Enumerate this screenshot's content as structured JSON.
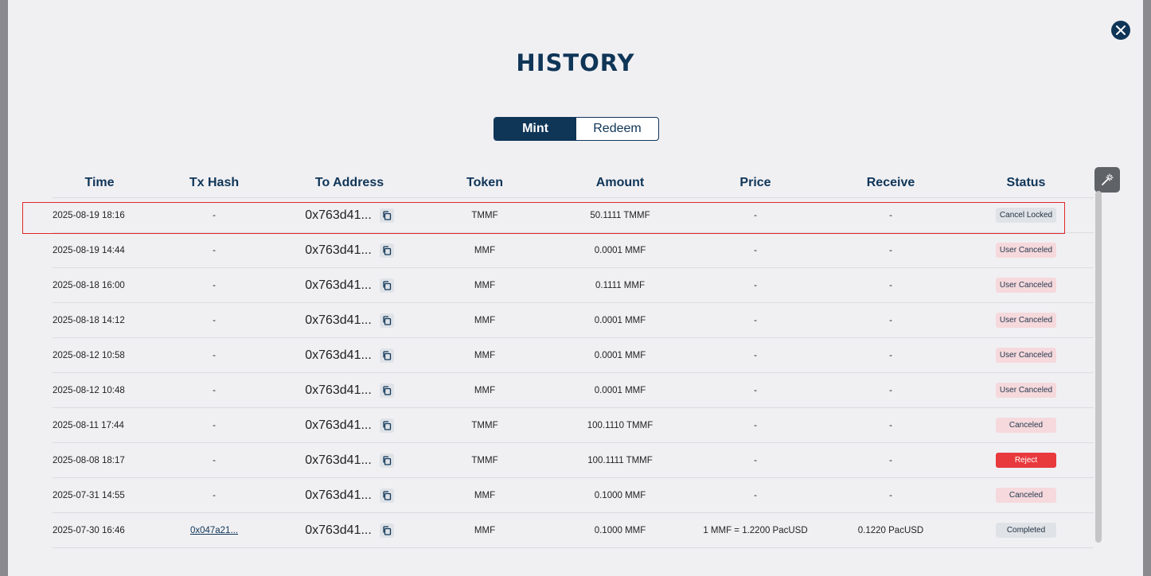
{
  "modal": {
    "title": "HISTORY",
    "close_icon": "close-icon"
  },
  "tabs": [
    {
      "label": "Mint",
      "active": true
    },
    {
      "label": "Redeem",
      "active": false
    }
  ],
  "columns": [
    "Time",
    "Tx Hash",
    "To Address",
    "Token",
    "Amount",
    "Price",
    "Receive",
    "Status"
  ],
  "rows": [
    {
      "time": "2025-08-19 18:16",
      "hash": "-",
      "address": "0x763d41...",
      "token": "TMMF",
      "amount": "50.1111 TMMF",
      "price": "-",
      "receive": "-",
      "status": "Cancel Locked",
      "status_type": "locked"
    },
    {
      "time": "2025-08-19 14:44",
      "hash": "-",
      "address": "0x763d41...",
      "token": "MMF",
      "amount": "0.0001 MMF",
      "price": "-",
      "receive": "-",
      "status": "User Canceled",
      "status_type": "cancel"
    },
    {
      "time": "2025-08-18 16:00",
      "hash": "-",
      "address": "0x763d41...",
      "token": "MMF",
      "amount": "0.1111 MMF",
      "price": "-",
      "receive": "-",
      "status": "User Canceled",
      "status_type": "cancel"
    },
    {
      "time": "2025-08-18 14:12",
      "hash": "-",
      "address": "0x763d41...",
      "token": "MMF",
      "amount": "0.0001 MMF",
      "price": "-",
      "receive": "-",
      "status": "User Canceled",
      "status_type": "cancel"
    },
    {
      "time": "2025-08-12 10:58",
      "hash": "-",
      "address": "0x763d41...",
      "token": "MMF",
      "amount": "0.0001 MMF",
      "price": "-",
      "receive": "-",
      "status": "User Canceled",
      "status_type": "cancel"
    },
    {
      "time": "2025-08-12 10:48",
      "hash": "-",
      "address": "0x763d41...",
      "token": "MMF",
      "amount": "0.0001 MMF",
      "price": "-",
      "receive": "-",
      "status": "User Canceled",
      "status_type": "cancel"
    },
    {
      "time": "2025-08-11 17:44",
      "hash": "-",
      "address": "0x763d41...",
      "token": "TMMF",
      "amount": "100.1110 TMMF",
      "price": "-",
      "receive": "-",
      "status": "Canceled",
      "status_type": "cancel"
    },
    {
      "time": "2025-08-08 18:17",
      "hash": "-",
      "address": "0x763d41...",
      "token": "TMMF",
      "amount": "100.1111 TMMF",
      "price": "-",
      "receive": "-",
      "status": "Reject",
      "status_type": "reject"
    },
    {
      "time": "2025-07-31 14:55",
      "hash": "-",
      "address": "0x763d41...",
      "token": "MMF",
      "amount": "0.1000 MMF",
      "price": "-",
      "receive": "-",
      "status": "Canceled",
      "status_type": "cancel"
    },
    {
      "time": "2025-07-30 16:46",
      "hash": "0x047a21...",
      "hash_link": true,
      "address": "0x763d41...",
      "token": "MMF",
      "amount": "0.1000 MMF",
      "price": "1 MMF = 1.2200 PacUSD",
      "receive": "0.1220 PacUSD",
      "status": "Completed",
      "status_type": "complete"
    }
  ],
  "colors": {
    "primary": "#0f3557",
    "reject": "#e8393d",
    "cancel_bg": "#f6d9dc",
    "neutral_bg": "#dfe3e8",
    "highlight": "#e0262b"
  }
}
